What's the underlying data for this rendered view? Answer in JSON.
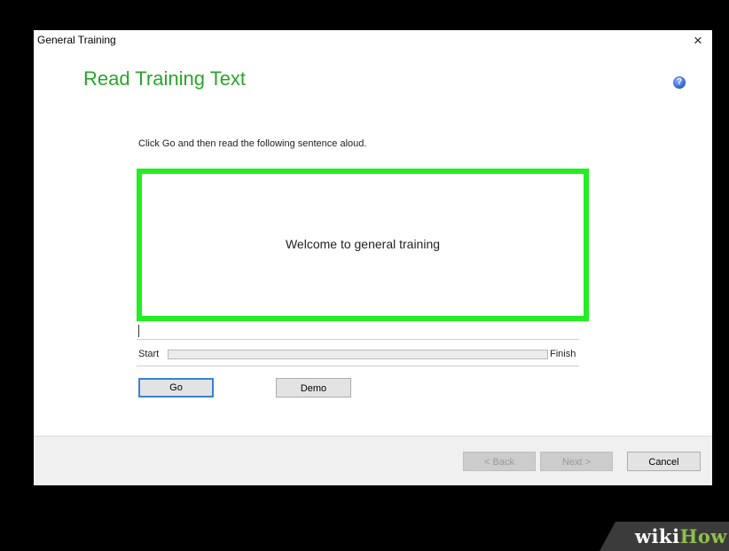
{
  "window": {
    "title": "General Training",
    "close_glyph": "×"
  },
  "page": {
    "heading": "Read Training Text",
    "help_glyph": "?",
    "instruction": "Click Go and then read the following sentence aloud.",
    "sentence": "Welcome to general training"
  },
  "progress": {
    "start_label": "Start",
    "finish_label": "Finish",
    "value": 0.0
  },
  "buttons": {
    "go": "Go",
    "demo": "Demo"
  },
  "footer": {
    "back": "< Back",
    "next": "Next >",
    "cancel": "Cancel"
  },
  "watermark": {
    "part1": "wiki",
    "part2": "How"
  },
  "colors": {
    "heading": "#2aa52a",
    "text_border": "#22ee22",
    "focus": "#3c7fd6"
  },
  "icons": {
    "help": "help-icon",
    "close": "close-icon"
  }
}
